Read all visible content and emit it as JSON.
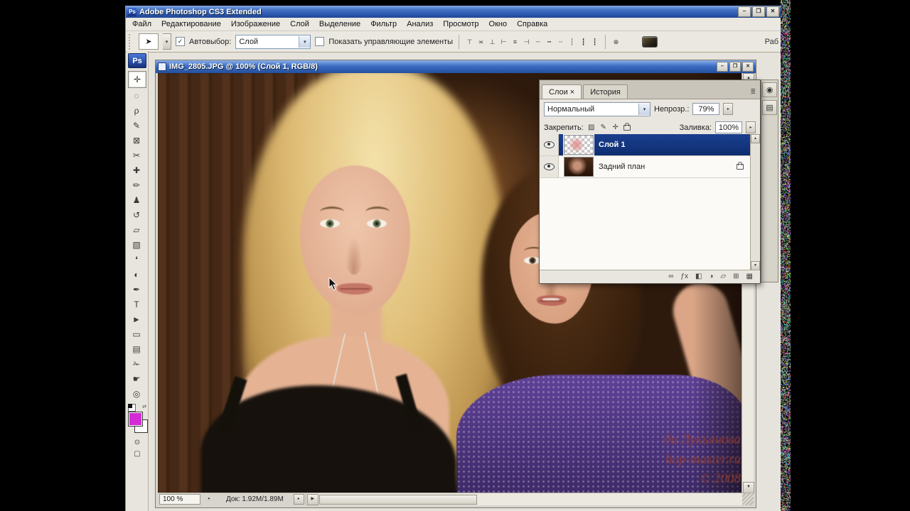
{
  "app": {
    "title": "Adobe Photoshop CS3 Extended",
    "logo_text": "Ps",
    "buttons": {
      "minimize": "‒",
      "maximize": "❐",
      "close": "✕"
    }
  },
  "menu": {
    "items": [
      {
        "label": "Файл"
      },
      {
        "label": "Редактирование"
      },
      {
        "label": "Изображение"
      },
      {
        "label": "Слой"
      },
      {
        "label": "Выделение"
      },
      {
        "label": "Фильтр"
      },
      {
        "label": "Анализ"
      },
      {
        "label": "Просмотр"
      },
      {
        "label": "Окно"
      },
      {
        "label": "Справка"
      }
    ]
  },
  "options_bar": {
    "tool_button_glyph": "➤",
    "tool_dropdown_glyph": "▾",
    "checkbox_check": "✓",
    "autoselect_label": "Автовыбор:",
    "autoselect_value": "Слой",
    "select_arrow": "▾",
    "show_controls_label": "Показать управляющие элементы",
    "align_icons": [
      {
        "name": "align-top-edges-icon",
        "glyph": "⊤"
      },
      {
        "name": "align-v-centers-icon",
        "glyph": "≍"
      },
      {
        "name": "align-bottom-edges-icon",
        "glyph": "⊥"
      },
      {
        "name": "align-left-edges-icon",
        "glyph": "⊢"
      },
      {
        "name": "align-h-centers-icon",
        "glyph": "≡"
      },
      {
        "name": "align-right-edges-icon",
        "glyph": "⊣"
      },
      {
        "name": "distribute-top-edges-icon",
        "glyph": "┄"
      },
      {
        "name": "distribute-v-centers-icon",
        "glyph": "┅"
      },
      {
        "name": "distribute-bottom-edges-icon",
        "glyph": "┈"
      },
      {
        "name": "distribute-left-edges-icon",
        "glyph": "┆"
      },
      {
        "name": "distribute-h-centers-icon",
        "glyph": "┇"
      },
      {
        "name": "distribute-right-edges-icon",
        "glyph": "┋"
      }
    ],
    "auto_align_glyph": "⊕",
    "workspace_fragment": "Раб"
  },
  "toolbar": {
    "tools": [
      {
        "name": "move-tool",
        "glyph": "✛",
        "selected": true
      },
      {
        "name": "marquee-tool",
        "glyph": "◌"
      },
      {
        "name": "lasso-tool",
        "glyph": "ρ"
      },
      {
        "name": "quick-selection-tool",
        "glyph": "✎"
      },
      {
        "name": "crop-tool",
        "glyph": "⊠"
      },
      {
        "name": "slice-tool",
        "glyph": "✂"
      },
      {
        "name": "healing-brush-tool",
        "glyph": "✚"
      },
      {
        "name": "brush-tool",
        "glyph": "✏"
      },
      {
        "name": "clone-stamp-tool",
        "glyph": "♟"
      },
      {
        "name": "history-brush-tool",
        "glyph": "↺"
      },
      {
        "name": "eraser-tool",
        "glyph": "▱"
      },
      {
        "name": "gradient-tool",
        "glyph": "▧"
      },
      {
        "name": "blur-tool",
        "glyph": "❛"
      },
      {
        "name": "dodge-tool",
        "glyph": "◐"
      },
      {
        "name": "pen-tool",
        "glyph": "✒"
      },
      {
        "name": "type-tool",
        "glyph": "T"
      },
      {
        "name": "path-selection-tool",
        "glyph": "►"
      },
      {
        "name": "shape-tool",
        "glyph": "▭"
      },
      {
        "name": "notes-tool",
        "glyph": "▤"
      },
      {
        "name": "eyedropper-tool",
        "glyph": "✁"
      },
      {
        "name": "hand-tool",
        "glyph": "☛"
      },
      {
        "name": "zoom-tool",
        "glyph": "◎"
      }
    ],
    "quick_mask_glyph": "⊙",
    "screen_mode_glyph": "▢",
    "swap_colors_glyph": "⇄"
  },
  "colors": {
    "foreground": "#d42bd4",
    "background": "#ffffff",
    "selected_layer": "#10317e",
    "titlebar_blue": "#2c58ae"
  },
  "document": {
    "title": "IMG_2805.JPG @ 100% (Слой 1, RGB/8)",
    "status": {
      "zoom": "100 %",
      "clock_glyph": "◔",
      "size": "Док: 1.92M/1.89M",
      "popup_glyph": "▸"
    }
  },
  "layers_panel": {
    "tabs": [
      {
        "label": "Слои ×",
        "active": true
      },
      {
        "label": "История"
      }
    ],
    "panel_menu_glyph": "≣",
    "blend_mode": "Нормальный",
    "opacity_label": "Непрозр.:",
    "opacity_value": "79%",
    "spinner_glyph": "▸",
    "lock_label": "Закрепить:",
    "lock_icons": [
      {
        "name": "lock-transparency-icon",
        "glyph": "▨"
      },
      {
        "name": "lock-pixels-icon",
        "glyph": "✎"
      },
      {
        "name": "lock-position-icon",
        "glyph": "✛"
      }
    ],
    "fill_label": "Заливка:",
    "fill_value": "100%",
    "layers": [
      {
        "name": "Слой 1",
        "selected": true
      },
      {
        "name": "Задний план",
        "locked": true
      }
    ],
    "bottom_icons": [
      {
        "name": "link-layers-icon",
        "glyph": "∞"
      },
      {
        "name": "layer-style-icon",
        "glyph": "ƒx"
      },
      {
        "name": "layer-mask-icon",
        "glyph": "◧"
      },
      {
        "name": "adjustment-layer-icon",
        "glyph": "◑"
      },
      {
        "name": "layer-group-icon",
        "glyph": "▱"
      },
      {
        "name": "new-layer-icon",
        "glyph": "⊞"
      },
      {
        "name": "delete-layer-icon",
        "glyph": "▦"
      }
    ]
  },
  "dock": {
    "icons": [
      {
        "name": "dock-panel-icon-1",
        "glyph": "◉"
      },
      {
        "name": "dock-panel-icon-2",
        "glyph": "▤"
      }
    ]
  },
  "photo": {
    "watermark": {
      "line1": "да Лукьянова",
      "line2": "hop-master.ru",
      "line3": "© 2008"
    }
  }
}
